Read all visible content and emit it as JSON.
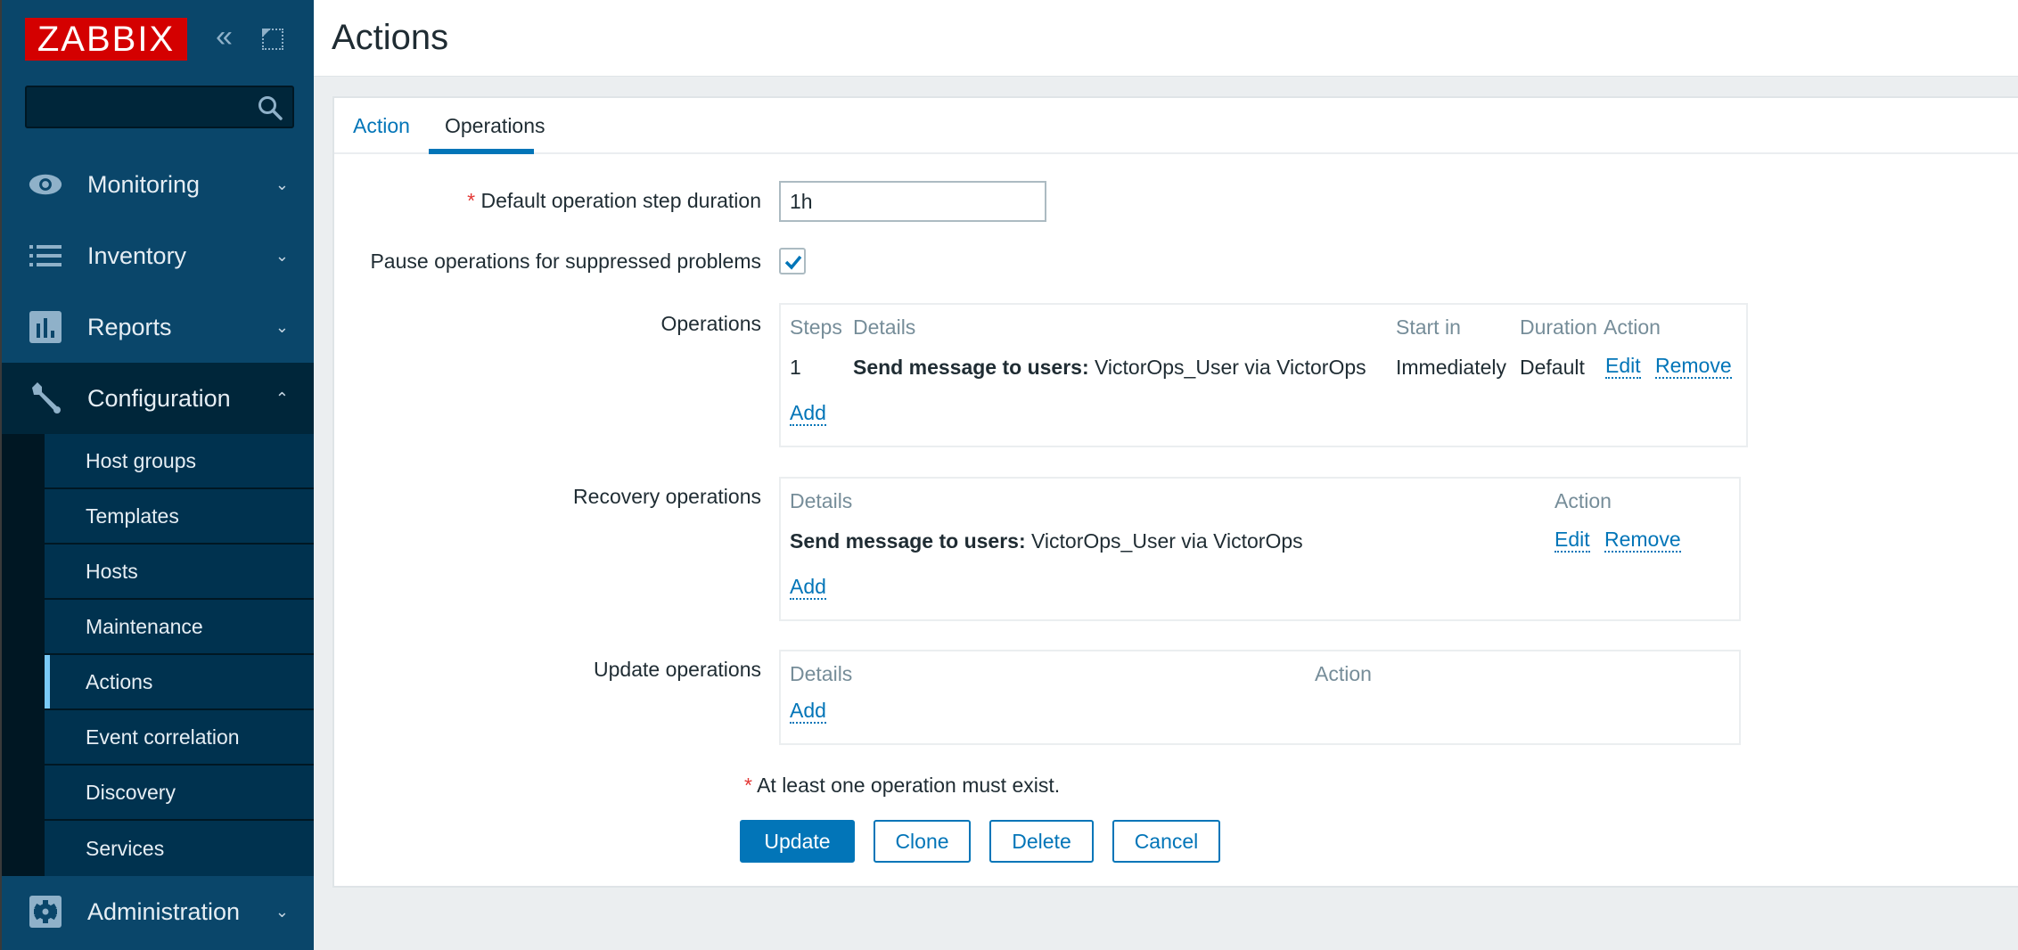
{
  "sidebar": {
    "logo": "ZABBIX",
    "collapse_icon": "«",
    "search": {
      "value": "",
      "placeholder": ""
    },
    "menu": [
      {
        "label": "Monitoring",
        "icon": "eye-icon",
        "chevron": "⌄"
      },
      {
        "label": "Inventory",
        "icon": "list-icon",
        "chevron": "⌄"
      },
      {
        "label": "Reports",
        "icon": "bar-chart-icon",
        "chevron": "⌄"
      },
      {
        "label": "Configuration",
        "icon": "wrench-icon",
        "chevron": "⌃"
      },
      {
        "label": "Administration",
        "icon": "gear-icon",
        "chevron": "⌄"
      }
    ],
    "submenu": [
      {
        "label": "Host groups"
      },
      {
        "label": "Templates"
      },
      {
        "label": "Hosts"
      },
      {
        "label": "Maintenance"
      },
      {
        "label": "Actions",
        "active": true
      },
      {
        "label": "Event correlation"
      },
      {
        "label": "Discovery"
      },
      {
        "label": "Services"
      }
    ]
  },
  "header": {
    "title": "Actions"
  },
  "tabs": [
    {
      "label": "Action",
      "active": false
    },
    {
      "label": "Operations",
      "active": true
    }
  ],
  "form": {
    "required_mark": "*",
    "step_duration": {
      "label": "Default operation step duration",
      "value": "1h"
    },
    "pause_suppressed": {
      "label": "Pause operations for suppressed problems",
      "checked": true
    },
    "operations": {
      "label": "Operations",
      "headers": {
        "steps": "Steps",
        "details": "Details",
        "start_in": "Start in",
        "duration": "Duration",
        "action": "Action"
      },
      "rows": [
        {
          "steps": "1",
          "details_bold": "Send message to users:",
          "details": " VictorOps_User via VictorOps",
          "start_in": "Immediately",
          "duration": "Default",
          "edit": "Edit",
          "remove": "Remove"
        }
      ],
      "add": "Add"
    },
    "recovery_operations": {
      "label": "Recovery operations",
      "headers": {
        "details": "Details",
        "action": "Action"
      },
      "rows": [
        {
          "details_bold": "Send message to users:",
          "details": " VictorOps_User via VictorOps",
          "edit": "Edit",
          "remove": "Remove"
        }
      ],
      "add": "Add"
    },
    "update_operations": {
      "label": "Update operations",
      "headers": {
        "details": "Details",
        "action": "Action"
      },
      "rows": [],
      "add": "Add"
    },
    "note": "At least one operation must exist.",
    "buttons": {
      "update": "Update",
      "clone": "Clone",
      "delete": "Delete",
      "cancel": "Cancel"
    }
  },
  "colors": {
    "sidebar": "#0a466a",
    "accent": "#0275b8",
    "logo": "#d40000",
    "required": "#e33734"
  }
}
